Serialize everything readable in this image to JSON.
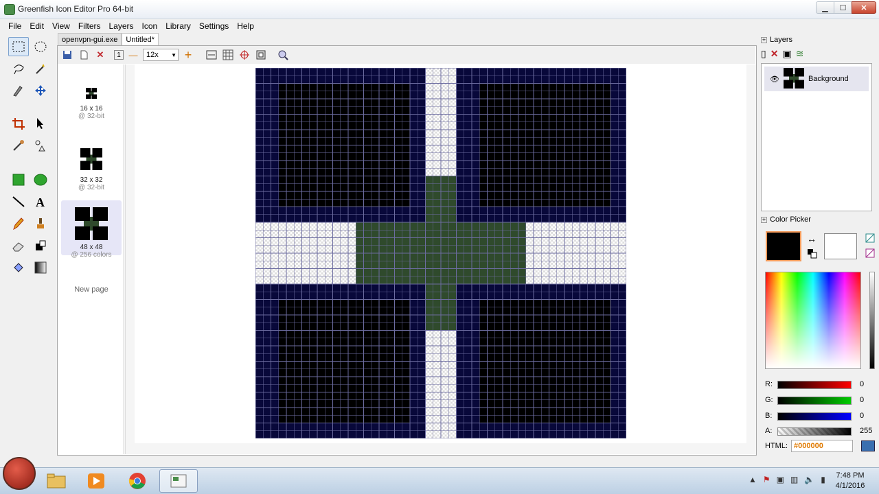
{
  "window": {
    "title": "Greenfish Icon Editor Pro 64-bit",
    "min": "▁",
    "max": "☐",
    "close": "✕"
  },
  "menu": [
    "File",
    "Edit",
    "View",
    "Filters",
    "Layers",
    "Icon",
    "Library",
    "Settings",
    "Help"
  ],
  "tabs": [
    {
      "label": "openvpn-gui.exe"
    },
    {
      "label": "Untitled*"
    }
  ],
  "doc_toolbar": {
    "zoom": "12x",
    "page_indicator": "1",
    "minus": "—",
    "plus": "+"
  },
  "pages": [
    {
      "size": "16 x 16",
      "depth": "@ 32-bit"
    },
    {
      "size": "32 x 32",
      "depth": "@ 32-bit"
    },
    {
      "size": "48 x 48",
      "depth": "@ 256 colors"
    }
  ],
  "new_page_label": "New page",
  "layers": {
    "title": "Layers",
    "items": [
      {
        "name": "Background"
      }
    ]
  },
  "color_picker": {
    "title": "Color Picker",
    "swap_glyph": "↔",
    "primary": "#000000",
    "secondary": "#ffffff",
    "r_label": "R:",
    "r": "0",
    "g_label": "G:",
    "g": "0",
    "b_label": "B:",
    "b": "0",
    "a_label": "A:",
    "a": "255",
    "html_label": "HTML:",
    "html": "#000000"
  },
  "colors": {
    "navy": "#08083a",
    "black": "#000000",
    "green": "#2f4a2c",
    "grid": "#6c6ca0"
  },
  "taskbar": {
    "clock_time": "7:48 PM",
    "clock_date": "4/1/2016"
  }
}
